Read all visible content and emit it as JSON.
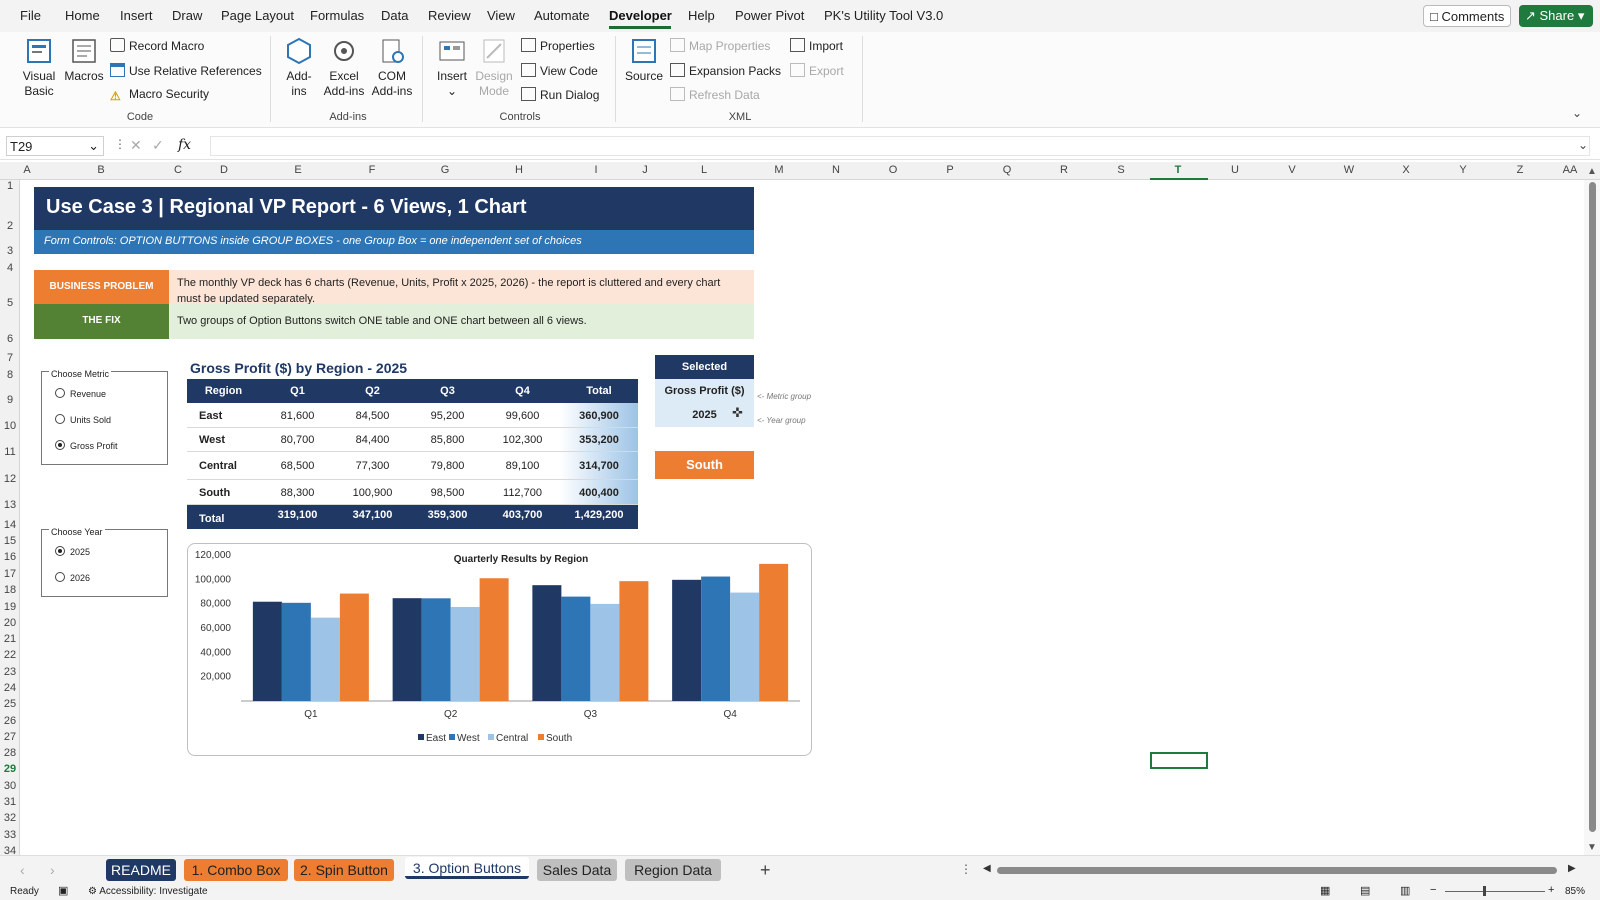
{
  "menu": {
    "items": [
      "File",
      "Home",
      "Insert",
      "Draw",
      "Page Layout",
      "Formulas",
      "Data",
      "Review",
      "View",
      "Automate",
      "Developer",
      "Help",
      "Power Pivot",
      "PK's Utility Tool V3.0"
    ],
    "active": "Developer",
    "comments": "Comments",
    "share": "Share"
  },
  "ribbon": {
    "code": {
      "visual_basic": "Visual Basic",
      "macros": "Macros",
      "record_macro": "Record Macro",
      "relative_refs": "Use Relative References",
      "macro_security": "Macro Security",
      "group": "Code"
    },
    "addins": {
      "addins": "Add-ins",
      "excel_addins": "Excel Add-ins",
      "com_addins": "COM Add-ins",
      "group": "Add-ins"
    },
    "controls": {
      "insert": "Insert",
      "design_mode": "Design Mode",
      "properties": "Properties",
      "view_code": "View Code",
      "run_dialog": "Run Dialog",
      "group": "Controls"
    },
    "xml": {
      "source": "Source",
      "map_properties": "Map Properties",
      "expansion_packs": "Expansion Packs",
      "refresh_data": "Refresh Data",
      "import": "Import",
      "export": "Export",
      "group": "XML"
    }
  },
  "formula_bar": {
    "name_box": "T29",
    "fx": "fx",
    "content": ""
  },
  "columns": [
    "A",
    "B",
    "C",
    "D",
    "E",
    "F",
    "G",
    "H",
    "I",
    "J",
    "L",
    "M",
    "N",
    "O",
    "P",
    "Q",
    "R",
    "S",
    "T",
    "U",
    "V",
    "W",
    "X",
    "Y",
    "Z",
    "AA"
  ],
  "rows": [
    "1",
    "2",
    "3",
    "4",
    "5",
    "6",
    "7",
    "8",
    "9",
    "10",
    "11",
    "12",
    "13",
    "14",
    "15",
    "16",
    "17",
    "18",
    "19",
    "20",
    "21",
    "22",
    "23",
    "24",
    "25",
    "26",
    "27",
    "28",
    "29",
    "30",
    "31",
    "32",
    "33",
    "34"
  ],
  "sheet": {
    "title": "Use Case 3  |  Regional VP Report - 6 Views, 1 Chart",
    "subtitle": "Form Controls: OPTION BUTTONS inside GROUP BOXES   -   one Group Box = one independent set of choices",
    "problem_tag": "BUSINESS PROBLEM",
    "problem_text": "The monthly VP deck has 6 charts (Revenue, Units, Profit x 2025, 2026) - the report is cluttered and every chart must be updated separately.",
    "fix_tag": "THE FIX",
    "fix_text": "Two groups of Option Buttons switch ONE table and ONE chart between all 6 views."
  },
  "metric_group": {
    "title": "Choose Metric",
    "options": [
      "Revenue",
      "Units Sold",
      "Gross Profit"
    ],
    "selected": 2
  },
  "year_group": {
    "title": "Choose Year",
    "options": [
      "2025",
      "2026"
    ],
    "selected": 0
  },
  "table": {
    "title": "Gross Profit ($)  by Region  -  2025",
    "headers": [
      "Region",
      "Q1",
      "Q2",
      "Q3",
      "Q4",
      "Total"
    ],
    "rows": [
      [
        "East",
        "81,600",
        "84,500",
        "95,200",
        "99,600",
        "360,900"
      ],
      [
        "West",
        "80,700",
        "84,400",
        "85,800",
        "102,300",
        "353,200"
      ],
      [
        "Central",
        "68,500",
        "77,300",
        "79,800",
        "89,100",
        "314,700"
      ],
      [
        "South",
        "88,300",
        "100,900",
        "98,500",
        "112,700",
        "400,400"
      ]
    ],
    "total_row": [
      "Total",
      "319,100",
      "347,100",
      "359,300",
      "403,700",
      "1,429,200"
    ]
  },
  "selected": {
    "header": "Selected",
    "metric": "Gross Profit ($)",
    "year": "2025",
    "metric_note": "<- Metric group",
    "year_note": "<- Year group",
    "top_region": "South"
  },
  "chart_data": {
    "type": "bar",
    "title": "Quarterly Results by Region",
    "categories": [
      "Q1",
      "Q2",
      "Q3",
      "Q4"
    ],
    "series": [
      {
        "name": "East",
        "values": [
          81600,
          84500,
          95200,
          99600
        ],
        "color": "#1f3864"
      },
      {
        "name": "West",
        "values": [
          80700,
          84400,
          85800,
          102300
        ],
        "color": "#2e75b6"
      },
      {
        "name": "Central",
        "values": [
          68500,
          77300,
          79800,
          89100
        ],
        "color": "#9dc3e6"
      },
      {
        "name": "South",
        "values": [
          88300,
          100900,
          98500,
          112700
        ],
        "color": "#ed7d31"
      }
    ],
    "yticks": [
      "20,000",
      "40,000",
      "60,000",
      "80,000",
      "100,000",
      "120,000"
    ],
    "ylim": [
      0,
      120000
    ],
    "legend": "bottom"
  },
  "tabs": [
    {
      "label": "README",
      "color": "#1f3864",
      "text": "#ffffff"
    },
    {
      "label": "1. Combo Box",
      "color": "#ed7d31",
      "text": "#222222"
    },
    {
      "label": "2. Spin Button",
      "color": "#ed7d31",
      "text": "#222222"
    },
    {
      "label": "3. Option Buttons",
      "color": "#ffffff",
      "text": "#1f3864"
    },
    {
      "label": "Sales Data",
      "color": "#bfbfbf",
      "text": "#222222"
    },
    {
      "label": "Region Data",
      "color": "#bfbfbf",
      "text": "#222222"
    }
  ],
  "add_sheet": "+",
  "status": {
    "ready": "Ready",
    "accessibility": "Accessibility: Investigate",
    "zoom": "85%"
  }
}
